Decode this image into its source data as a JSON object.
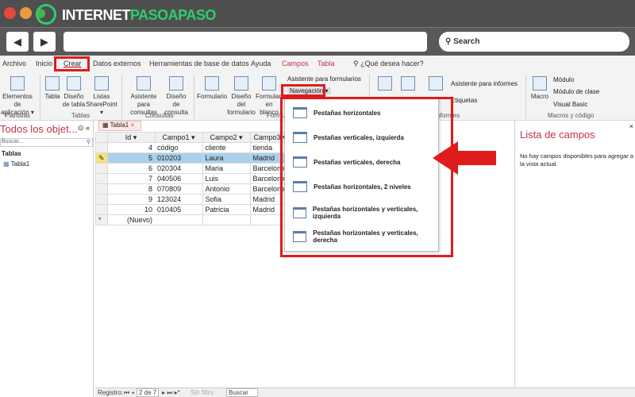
{
  "browser": {
    "brand_a": "INTERNET",
    "brand_b": "PASOAPASO",
    "search": "Search"
  },
  "ribbon_tabs": [
    "Archivo",
    "Inicio",
    "Crear",
    "Datos externos",
    "Herramientas de base de datos",
    "Ayuda",
    "Campos",
    "Tabla",
    "¿Qué desea hacer?"
  ],
  "ribbon": {
    "plantillas": {
      "btn": "Elementos de aplicación ▾",
      "group": "Plantillas"
    },
    "tablas": {
      "btns": [
        "Tabla",
        "Diseño de tabla",
        "Listas SharePoint ▾"
      ],
      "group": "Tablas"
    },
    "consultas": {
      "btns": [
        "Asistente para consultas",
        "Diseño de consulta"
      ],
      "group": "Consultas"
    },
    "formularios": {
      "btns": [
        "Formulario",
        "Diseño del formulario",
        "Formulario en blanco"
      ],
      "asistente": "Asistente para formularios",
      "navegacion": "Navegación ▾",
      "group": "Formularios"
    },
    "informes": {
      "asistente": "Asistente para informes",
      "etiquetas": "Etiquetas",
      "group": "Informes"
    },
    "macros": {
      "macro": "Macro",
      "modulo": "Módulo",
      "modulo_clase": "Módulo de clase",
      "vb": "Visual Basic",
      "group": "Macros y código"
    }
  },
  "nav_menu": [
    "Pestañas horizontales",
    "Pestañas verticales, izquierda",
    "Pestañas verticales, derecha",
    "Pestañas horizontales, 2 niveles",
    "Pestañas horizontales y verticales, izquierda",
    "Pestañas horizontales y verticales, derecha"
  ],
  "navpane": {
    "title": "Todos los objet...",
    "search": "Buscar...",
    "section": "Tablas",
    "item": "Tabla1"
  },
  "doc_tab": "Tabla1",
  "table": {
    "headers": [
      "Id",
      "Campo1",
      "Campo2",
      "Campo3"
    ],
    "rows": [
      [
        "4",
        "código",
        "cliente",
        "tienda"
      ],
      [
        "5",
        "010203",
        "Laura",
        "Madrid"
      ],
      [
        "6",
        "020304",
        "Maria",
        "Barcelona"
      ],
      [
        "7",
        "040506",
        "Luis",
        "Barcelona"
      ],
      [
        "8",
        "070809",
        "Antonio",
        "Barcelona"
      ],
      [
        "9",
        "123024",
        "Sofia",
        "Madrid"
      ],
      [
        "10",
        "010405",
        "Patricia",
        "Madrid"
      ]
    ],
    "new_row": "(Nuevo)"
  },
  "fields_panel": {
    "title": "Lista de campos",
    "message": "No hay campos disponibles para agregar a la vista actual."
  },
  "status": {
    "label": "Registro:",
    "position": "2 de 7",
    "filter": "Sin filtro",
    "search": "Buscar"
  }
}
